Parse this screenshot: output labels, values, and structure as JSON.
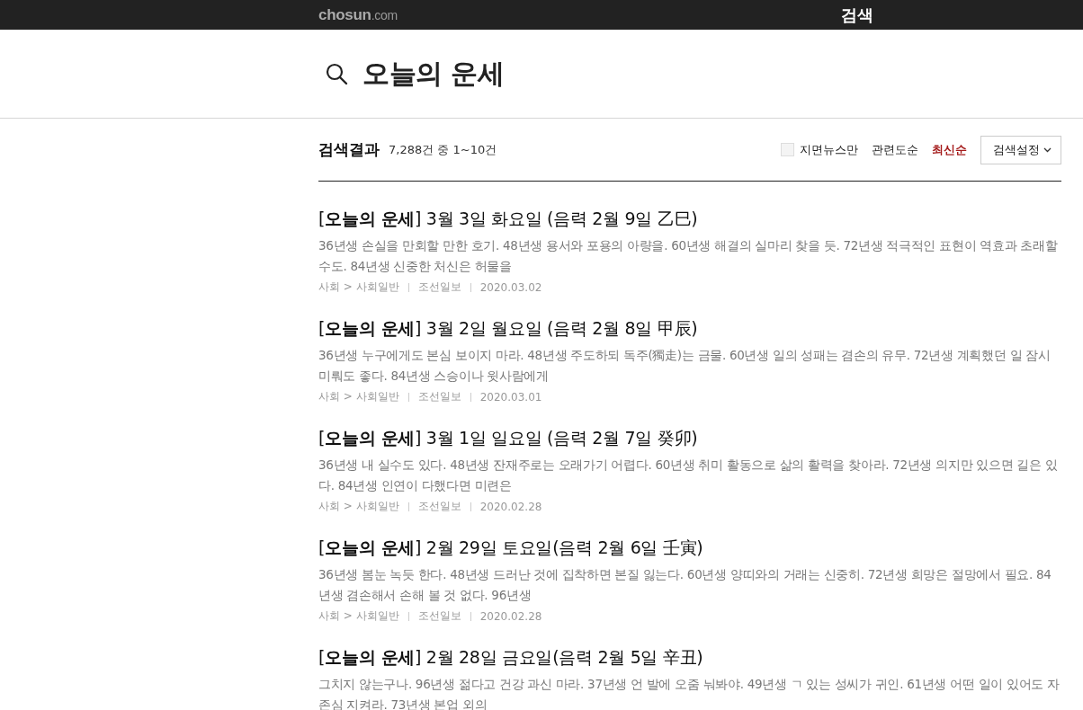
{
  "header": {
    "logo_main": "chosun",
    "logo_suffix": ".com",
    "title": "검색"
  },
  "search": {
    "query": "오늘의 운세"
  },
  "results_header": {
    "title": "검색결과",
    "count": "7,288건 중 1~10건",
    "filter": {
      "label": "지면뉴스만",
      "checked": false
    },
    "sort": [
      {
        "label": "관련도순",
        "selected": false
      },
      {
        "label": "최신순",
        "selected": true
      }
    ],
    "settings_button": "검색설정"
  },
  "results": [
    {
      "title": "[**오늘의 운세**] 3월 3일 화요일 (음력 2월 9일 乙巳)",
      "snippet": "36년생 손실을 만회할 만한 호기. 48년생 용서와 포용의 아량을. 60년생 해결의 실마리 찾을 듯. 72년생 적극적인 표현이 역효과 초래할 수도. 84년생 신중한 처신은 허물을",
      "section": "사회 > 사회일반",
      "source": "조선일보",
      "date": "2020.03.02"
    },
    {
      "title": "[**오늘의 운세**] 3월 2일 월요일 (음력 2월 8일 甲辰)",
      "snippet": "36년생 누구에게도 본심 보이지 마라. 48년생 주도하되 독주(獨走)는 금물. 60년생 일의 성패는 겸손의 유무. 72년생 계획했던 일 잠시 미뤄도 좋다. 84년생 스승이나 윗사람에게",
      "section": "사회 > 사회일반",
      "source": "조선일보",
      "date": "2020.03.01"
    },
    {
      "title": "[**오늘의 운세**] 3월 1일 일요일 (음력 2월 7일 癸卯)",
      "snippet": "36년생 내 실수도 있다. 48년생 잔재주로는 오래가기 어렵다. 60년생 취미 활동으로 삶의 활력을 찾아라. 72년생 의지만 있으면 길은 있다. 84년생 인연이 다했다면 미련은",
      "section": "사회 > 사회일반",
      "source": "조선일보",
      "date": "2020.02.28"
    },
    {
      "title": "[**오늘의 운세**] 2월 29일 토요일(음력 2월 6일 壬寅)",
      "snippet": "36년생 봄눈 녹듯 한다. 48년생 드러난 것에 집착하면 본질 잃는다. 60년생 양띠와의 거래는 신중히. 72년생 희망은 절망에서 필요. 84년생 겸손해서 손해 볼 것 없다. 96년생",
      "section": "사회 > 사회일반",
      "source": "조선일보",
      "date": "2020.02.28"
    },
    {
      "title": "[**오늘의 운세**] 2월 28일 금요일(음력 2월 5일 辛丑)",
      "snippet": "그치지 않는구나. 96년생 젊다고 건강 과신 마라. 37년생 언 발에 오줌 눠봐야. 49년생 ㄱ 있는 성씨가 귀인. 61년생 어떤 일이 있어도 자존심 지켜라. 73년생 본업 외의"
    }
  ]
}
